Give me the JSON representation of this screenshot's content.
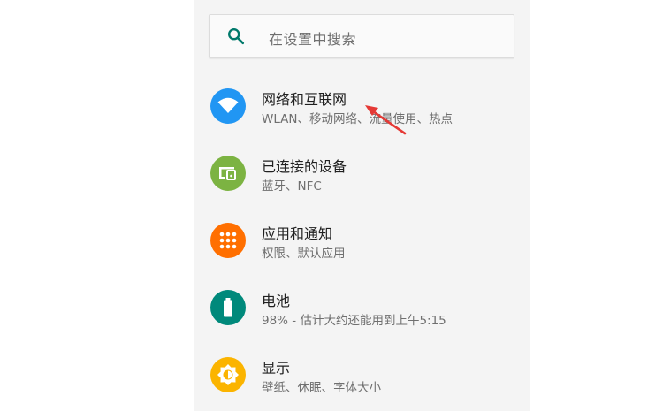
{
  "search": {
    "placeholder": "在设置中搜索"
  },
  "colors": {
    "network": "#2196f3",
    "devices": "#7cb342",
    "apps": "#ff6f00",
    "battery": "#00897b",
    "display": "#fbb400",
    "arrow": "#e53935",
    "search_icon": "#00796b"
  },
  "items": [
    {
      "title": "网络和互联网",
      "subtitle": "WLAN、移动网络、流量使用、热点",
      "icon": "wifi-icon"
    },
    {
      "title": "已连接的设备",
      "subtitle": "蓝牙、NFC",
      "icon": "connected-devices-icon"
    },
    {
      "title": "应用和通知",
      "subtitle": "权限、默认应用",
      "icon": "apps-grid-icon"
    },
    {
      "title": "电池",
      "subtitle": "98% - 估计大约还能用到上午5:15",
      "icon": "battery-icon"
    },
    {
      "title": "显示",
      "subtitle": "壁纸、休眠、字体大小",
      "icon": "brightness-icon"
    }
  ]
}
